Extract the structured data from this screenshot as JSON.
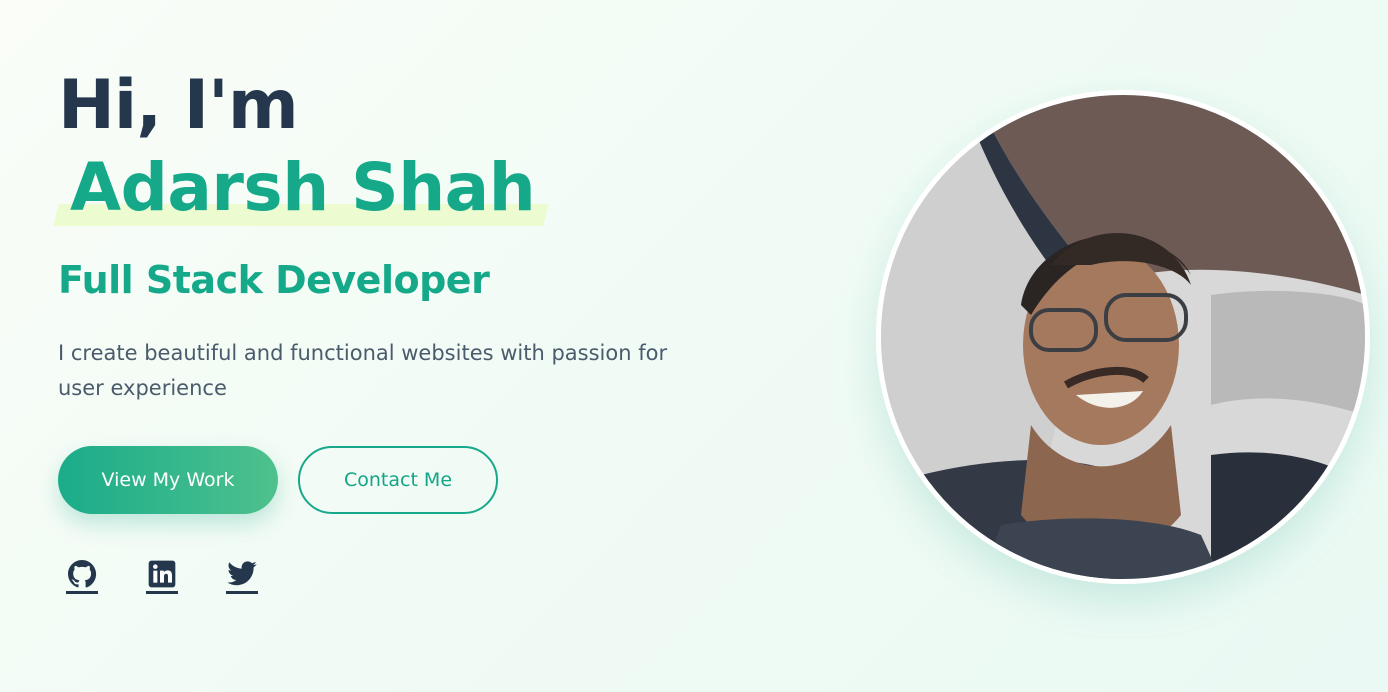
{
  "hero": {
    "greeting": "Hi, I'm",
    "name": "Adarsh Shah",
    "role": "Full Stack Developer",
    "description": "I create beautiful and functional websites with passion for user experience",
    "primary_button": "View My Work",
    "secondary_button": "Contact Me"
  },
  "socials": [
    {
      "icon": "github-icon"
    },
    {
      "icon": "linkedin-icon"
    },
    {
      "icon": "twitter-icon"
    }
  ],
  "colors": {
    "accent": "#15a98a",
    "heading": "#25374d",
    "text": "#4a5b6c",
    "highlight": "#ecfbd0"
  }
}
